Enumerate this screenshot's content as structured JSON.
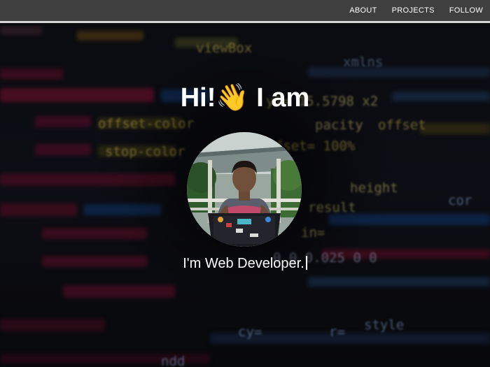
{
  "nav": {
    "items": [
      "ABOUT",
      "PROJECTS",
      "FOLLOW"
    ]
  },
  "hero": {
    "title": "Hi!⁠! I am",
    "title_display": "Hi!👋 I am",
    "subtitle": "I'm Web Developer.",
    "avatar_icon": "profile-photo",
    "background": "blurred-code-screenshot"
  },
  "colors": {
    "navbar": "#3f3f3f",
    "navbar_border": "#d6d6d6",
    "text": "#ffffff",
    "hero_bg": "#0a0b0f"
  }
}
